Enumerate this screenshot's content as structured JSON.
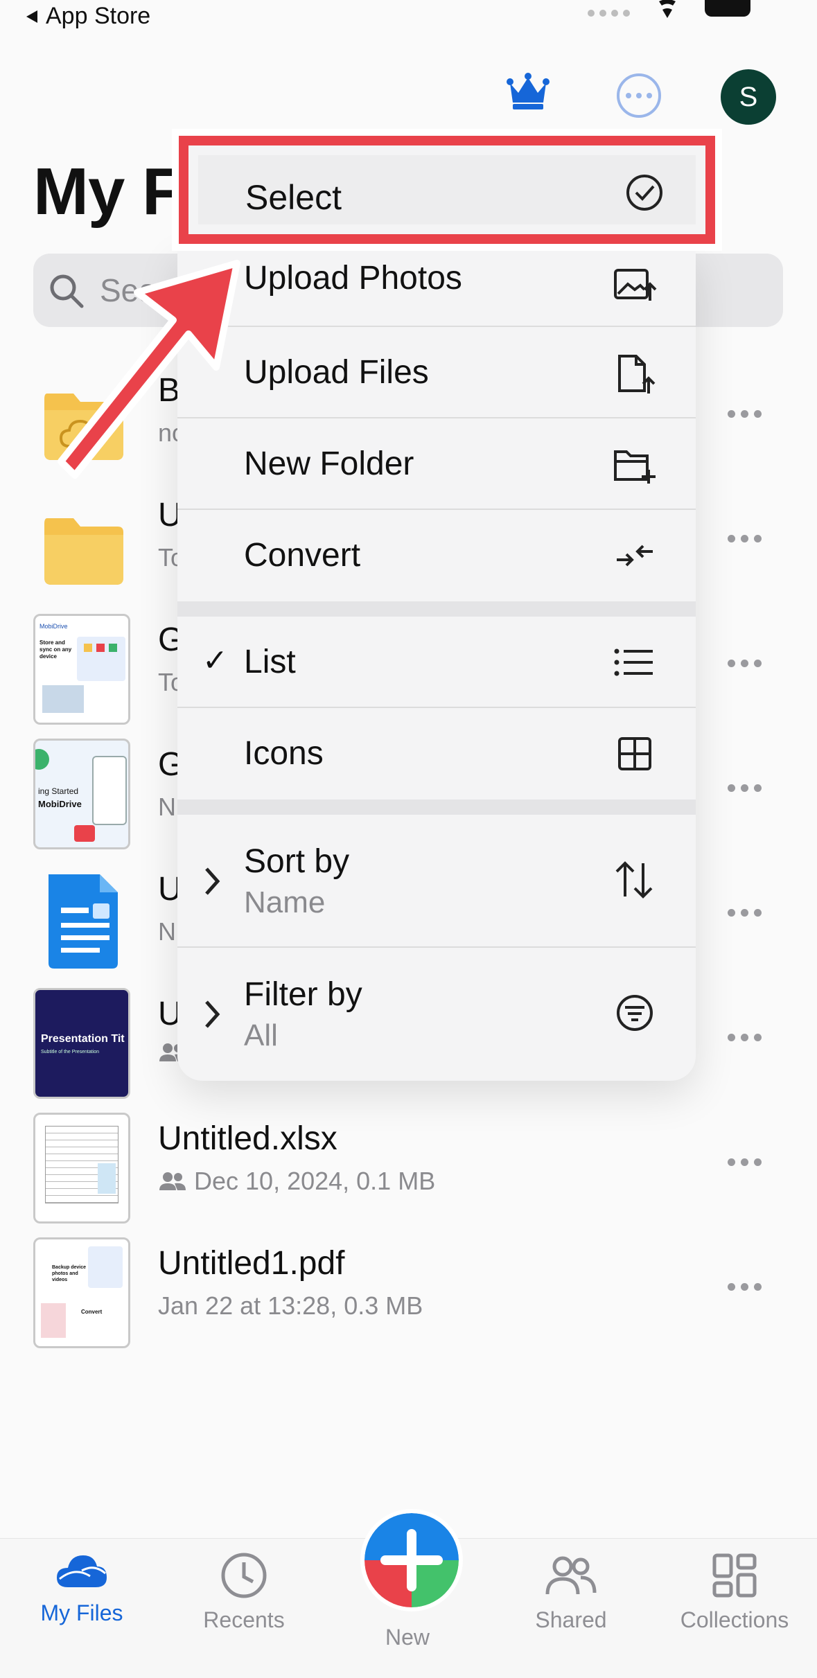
{
  "status_bar": {
    "back_label": "App Store"
  },
  "header": {
    "title": "My Files",
    "avatar_letter": "S"
  },
  "search": {
    "placeholder": "Search"
  },
  "files": [
    {
      "name": "B",
      "meta": "no"
    },
    {
      "name": "U",
      "meta": "To"
    },
    {
      "name": "G",
      "meta": "To"
    },
    {
      "name": "G",
      "meta": "N"
    },
    {
      "name": "U",
      "meta": "N"
    },
    {
      "name": "U",
      "meta": ""
    },
    {
      "name": "Untitled.xlsx",
      "meta": "Dec 10, 2024, 0.1 MB"
    },
    {
      "name": "Untitled1.pdf",
      "meta": "Jan 22 at 13:28, 0.3 MB"
    }
  ],
  "thumbs": {
    "mobidrive_brand": "MobiDrive",
    "store_sync": "Store and sync on any device",
    "getting_started": "ing Started",
    "presentation_title": "Presentation Tit",
    "presentation_sub": "Subtitle of the Presentation",
    "backup": "Backup device photos and videos",
    "convert": "Convert"
  },
  "menu": {
    "select": "Select",
    "upload_photos": "Upload Photos",
    "upload_files": "Upload Files",
    "new_folder": "New Folder",
    "convert": "Convert",
    "list": "List",
    "icons": "Icons",
    "sort_by": "Sort by",
    "sort_value": "Name",
    "filter_by": "Filter by",
    "filter_value": "All"
  },
  "tabs": {
    "my_files": "My Files",
    "recents": "Recents",
    "new": "New",
    "shared": "Shared",
    "collections": "Collections"
  },
  "colors": {
    "accent": "#1666d8",
    "highlight": "#e9424a",
    "avatar_bg": "#0b3f33"
  }
}
